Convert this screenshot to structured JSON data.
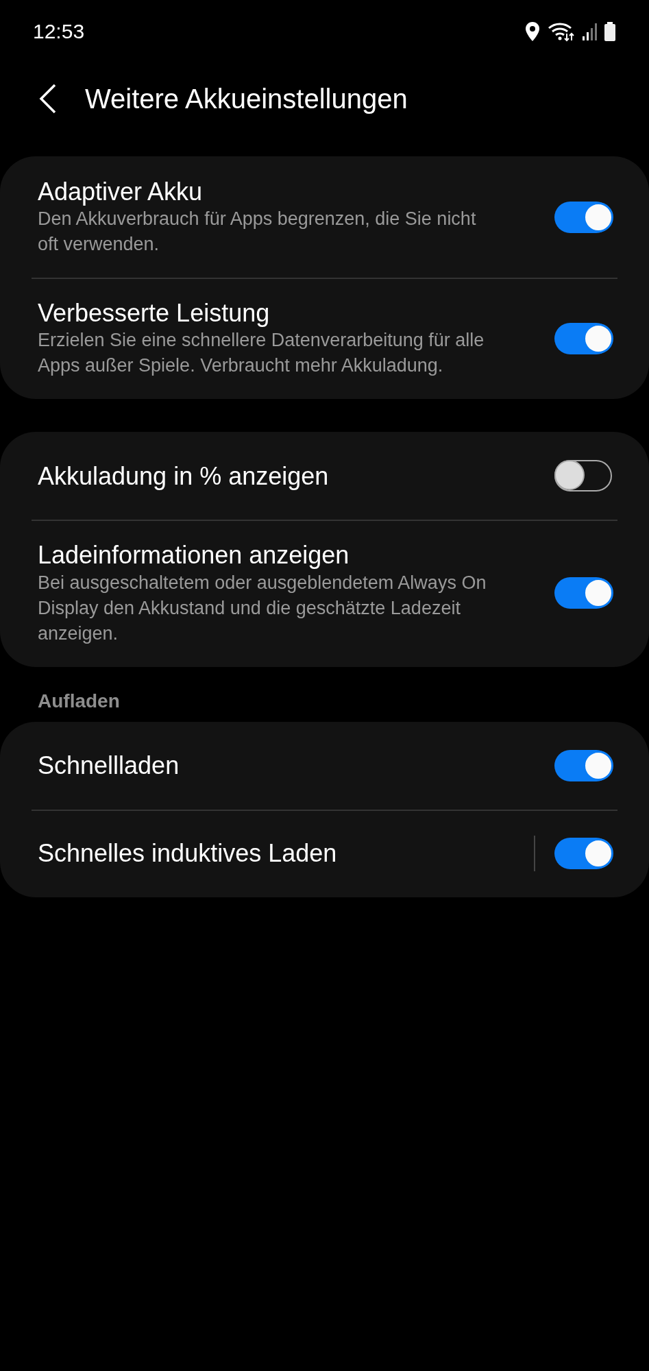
{
  "status_bar": {
    "time": "12:53"
  },
  "header": {
    "title": "Weitere Akkueinstellungen"
  },
  "sections": [
    {
      "items": [
        {
          "title": "Adaptiver Akku",
          "description": "Den Akkuverbrauch für Apps begrenzen, die Sie nicht oft verwenden.",
          "on": true,
          "divider": false
        },
        {
          "title": "Verbesserte Leistung",
          "description": "Erzielen Sie eine schnellere Datenverarbeitung für alle Apps außer Spiele. Verbraucht mehr Akkuladung.",
          "on": true,
          "divider": false
        }
      ]
    },
    {
      "items": [
        {
          "title": "Akkuladung in % anzeigen",
          "on": false,
          "divider": false
        },
        {
          "title": "Ladeinformationen anzeigen",
          "description": "Bei ausgeschaltetem oder ausgeblendetem Always On Display den Akkustand und die geschätzte Ladezeit anzeigen.",
          "on": true,
          "divider": false
        }
      ]
    },
    {
      "header": "Aufladen",
      "items": [
        {
          "title": "Schnellladen",
          "on": true,
          "divider": false
        },
        {
          "title": "Schnelles induktives Laden",
          "on": true,
          "divider": true
        }
      ]
    }
  ]
}
